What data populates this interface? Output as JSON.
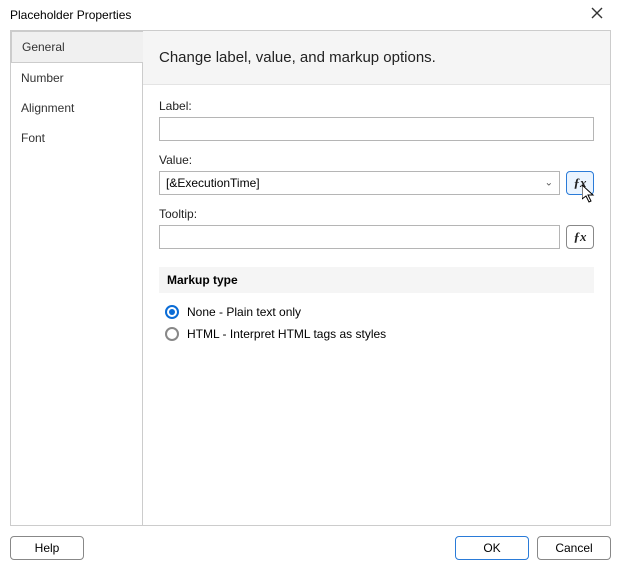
{
  "window": {
    "title": "Placeholder Properties"
  },
  "sidebar": {
    "tabs": [
      {
        "label": "General"
      },
      {
        "label": "Number"
      },
      {
        "label": "Alignment"
      },
      {
        "label": "Font"
      }
    ]
  },
  "panel": {
    "heading": "Change label, value, and markup options.",
    "label_field": {
      "label": "Label:",
      "value": ""
    },
    "value_field": {
      "label": "Value:",
      "value": "[&ExecutionTime]"
    },
    "tooltip_field": {
      "label": "Tooltip:",
      "value": ""
    },
    "markup": {
      "section_title": "Markup type",
      "options": [
        {
          "label": "None - Plain text only",
          "checked": true
        },
        {
          "label": "HTML - Interpret HTML tags as styles",
          "checked": false
        }
      ]
    }
  },
  "footer": {
    "help": "Help",
    "ok": "OK",
    "cancel": "Cancel"
  },
  "fx_glyph": "ƒx"
}
